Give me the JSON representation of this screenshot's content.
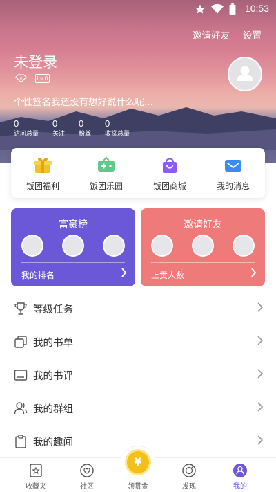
{
  "status_bar": {
    "time": "10:53"
  },
  "header": {
    "invite_label": "邀请好友",
    "settings_label": "设置",
    "username": "未登录",
    "level_badge": "Lv.0",
    "signature": "个性签名我还没有想好说什么呢...",
    "stats": [
      {
        "value": "0",
        "label": "访问总量"
      },
      {
        "value": "0",
        "label": "关注"
      },
      {
        "value": "0",
        "label": "粉丝"
      },
      {
        "value": "0",
        "label": "收赏总量"
      }
    ]
  },
  "quick_menu": [
    {
      "label": "饭团福利",
      "icon": "gift-box-icon"
    },
    {
      "label": "饭团乐园",
      "icon": "game-controller-icon"
    },
    {
      "label": "饭团商城",
      "icon": "shopping-bag-icon"
    },
    {
      "label": "我的消息",
      "icon": "mail-icon"
    }
  ],
  "rank_cards": {
    "rich": {
      "title": "富豪榜",
      "footer": "我的排名"
    },
    "invite": {
      "title": "邀请好友",
      "footer": "上贡人数"
    }
  },
  "list": [
    {
      "label": "等级任务",
      "icon": "trophy-icon"
    },
    {
      "label": "我的书单",
      "icon": "book-list-icon"
    },
    {
      "label": "我的书评",
      "icon": "review-icon"
    },
    {
      "label": "我的群组",
      "icon": "group-icon"
    },
    {
      "label": "我的趣闻",
      "icon": "clipboard-icon"
    }
  ],
  "tabs": [
    {
      "label": "收藏夹",
      "icon": "favorites-icon"
    },
    {
      "label": "社区",
      "icon": "community-icon"
    },
    {
      "label": "领赏金",
      "icon": "coin-icon",
      "symbol": "¥"
    },
    {
      "label": "发现",
      "icon": "discover-icon"
    },
    {
      "label": "我的",
      "icon": "profile-icon"
    }
  ],
  "colors": {
    "accent_purple": "#6a58d8",
    "accent_red": "#ee7a7a",
    "coin_yellow": "#f5bf1a"
  }
}
